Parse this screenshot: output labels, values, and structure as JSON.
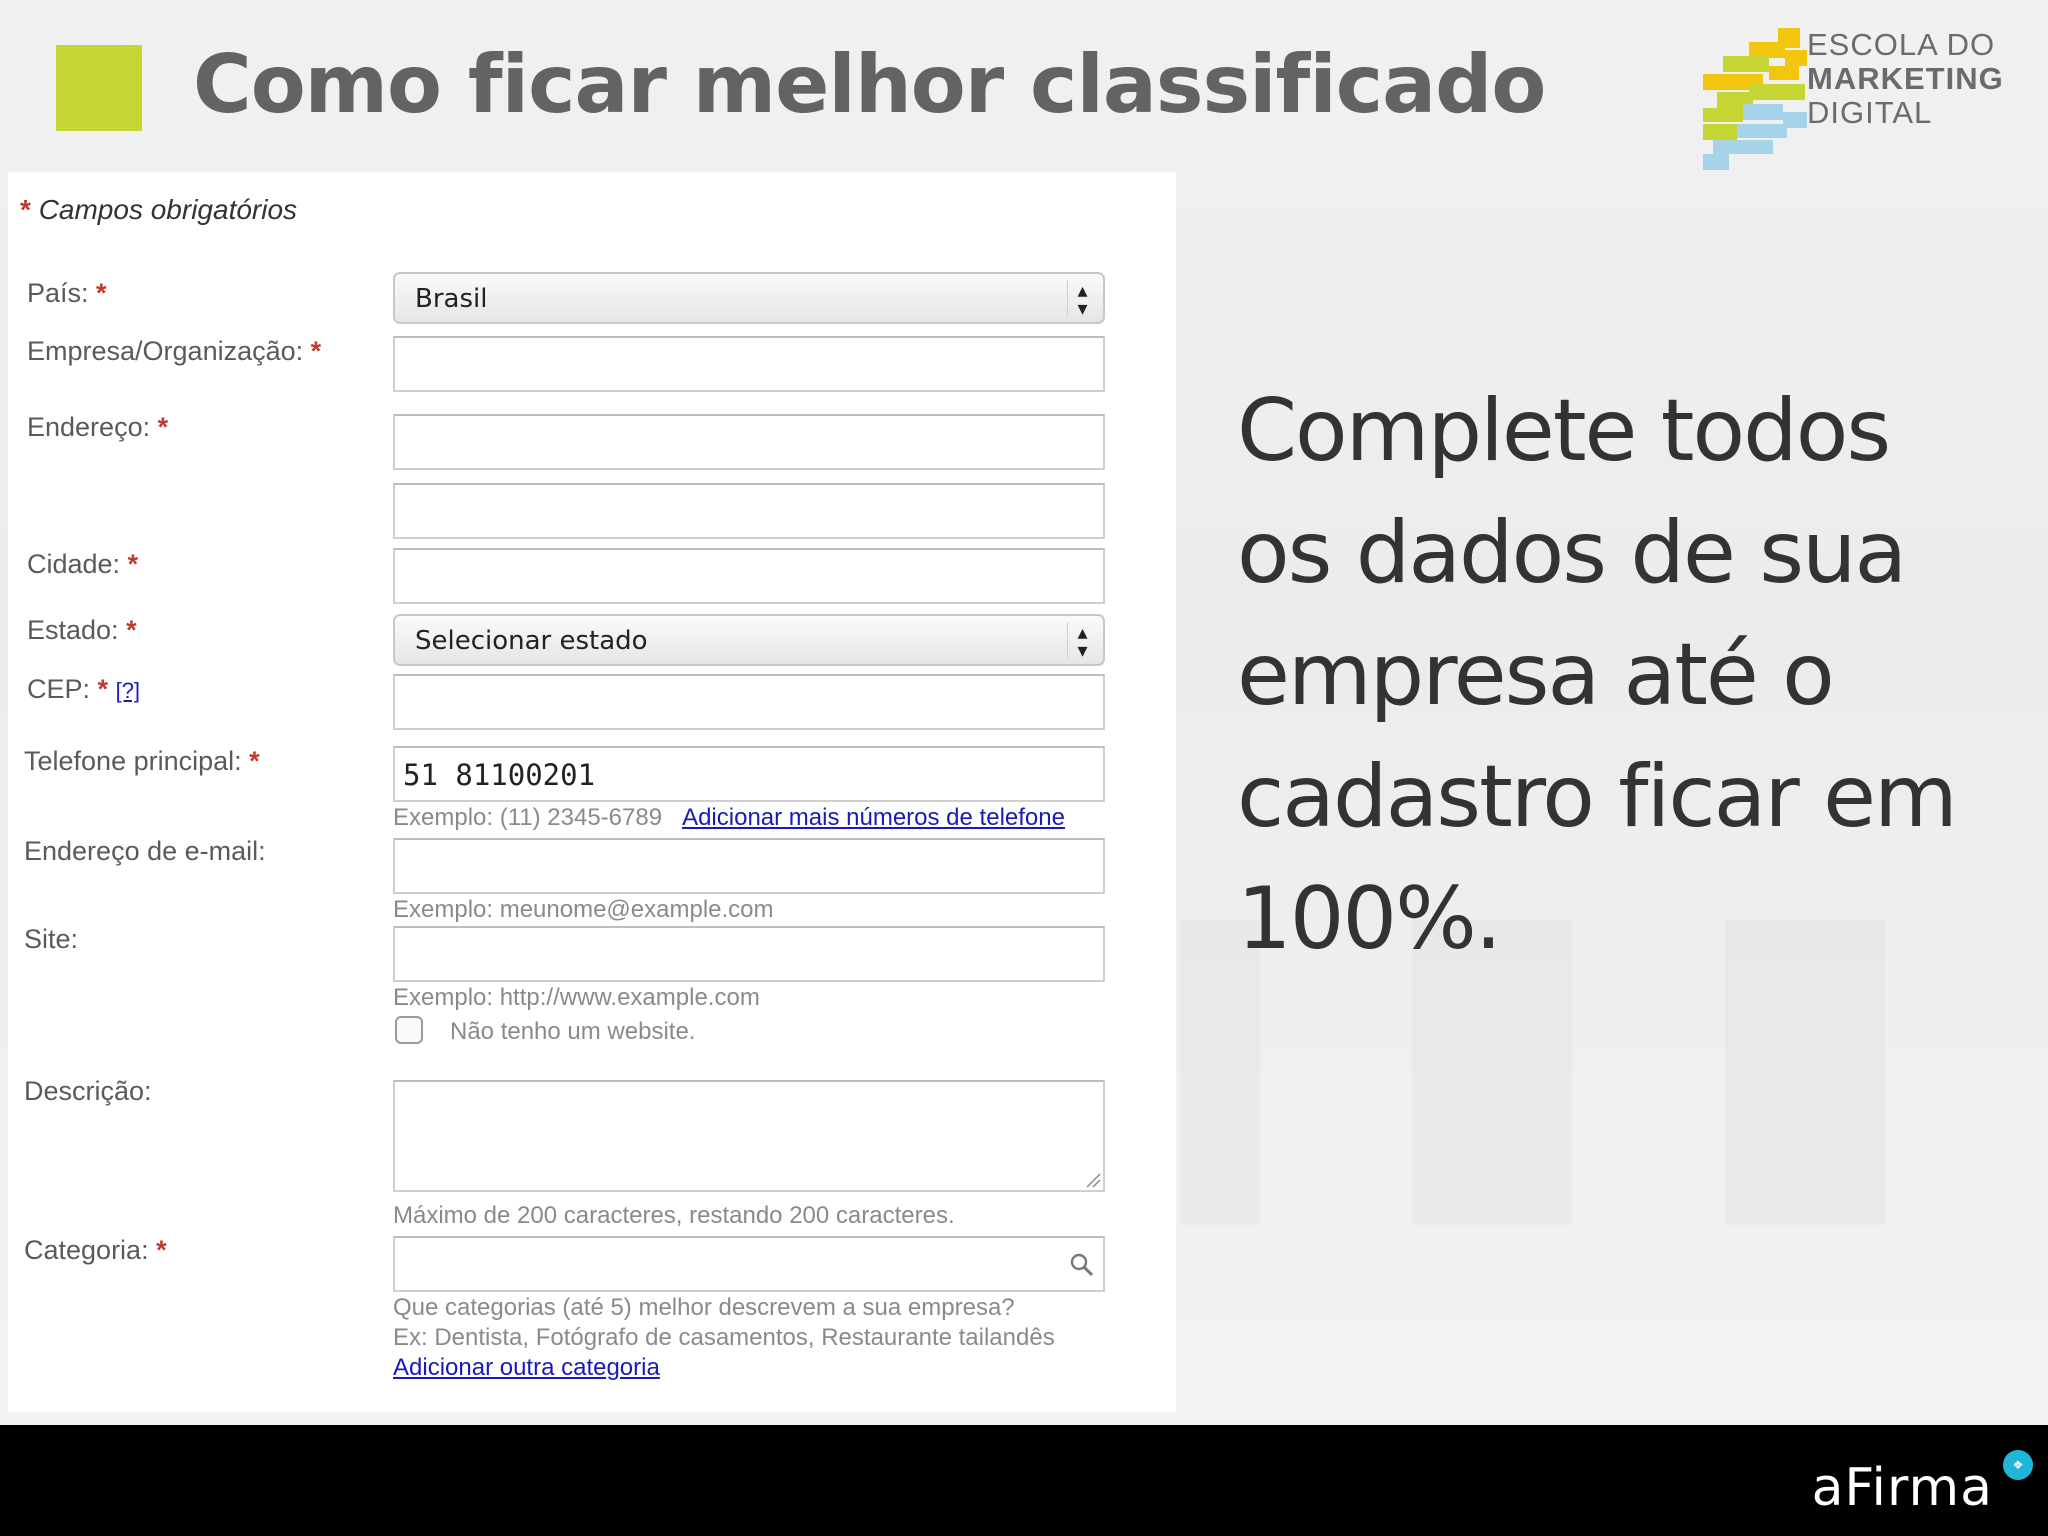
{
  "header": {
    "title": "Como ficar melhor classificado",
    "accent_color": "#c4d534"
  },
  "logo": {
    "line1": "ESCOLA DO",
    "line2": "MARKETING",
    "line3": "DIGITAL"
  },
  "form": {
    "required_note": "Campos obrigatórios",
    "required_marker": "*",
    "fields": {
      "pais": {
        "label": "País:",
        "value": "Brasil"
      },
      "empresa": {
        "label": "Empresa/Organização:"
      },
      "endereco": {
        "label": "Endereço:"
      },
      "cidade": {
        "label": "Cidade:"
      },
      "estado": {
        "label": "Estado:",
        "value": "Selecionar estado"
      },
      "cep": {
        "label": "CEP:",
        "help_link": "[?]"
      },
      "telefone": {
        "label": "Telefone principal:",
        "value": "51 81100201",
        "hint": "Exemplo: (11) 2345-6789",
        "add_link": "Adicionar mais números de telefone"
      },
      "email": {
        "label": "Endereço de e-mail:",
        "hint": "Exemplo: meunome@example.com"
      },
      "site": {
        "label": "Site:",
        "hint": "Exemplo: http://www.example.com",
        "checkbox_label": "Não tenho um website."
      },
      "descricao": {
        "label": "Descrição:",
        "hint": "Máximo de 200 caracteres, restando 200 caracteres."
      },
      "categoria": {
        "label": "Categoria:",
        "hint1": "Que categorias (até 5) melhor descrevem a sua empresa?",
        "hint2": "Ex: Dentista, Fotógrafo de casamentos, Restaurante tailandês",
        "add_link": "Adicionar outra categoria"
      }
    }
  },
  "body_text": {
    "line1": "Complete todos",
    "line2": "os dados de sua",
    "line3": "empresa até o",
    "line4": "cadastro ficar em",
    "line5": "100%."
  },
  "footer": {
    "brand": "aFirma",
    "brand_color": "#1fb6d7"
  }
}
